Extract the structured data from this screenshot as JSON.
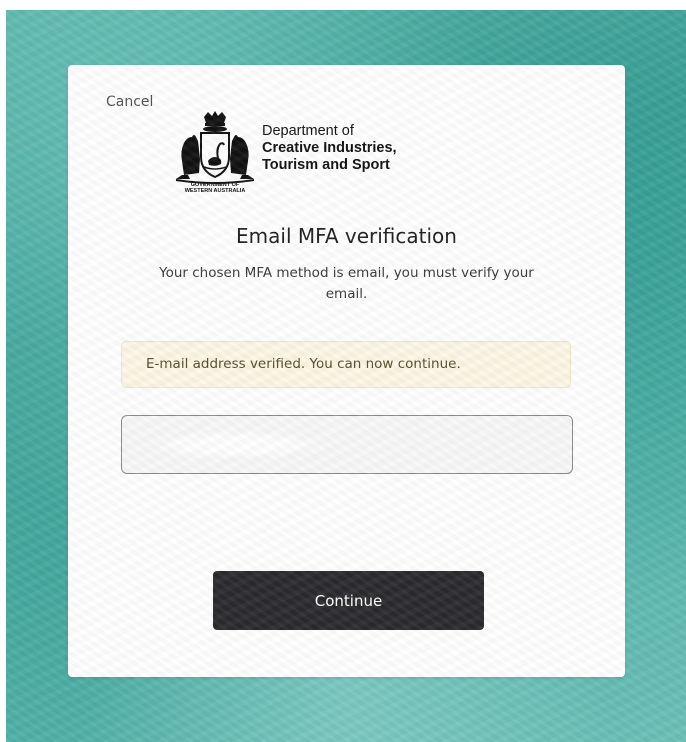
{
  "page": {
    "cancel_label": "Cancel",
    "logo": {
      "crest_caption_line1": "GOVERNMENT OF",
      "crest_caption_line2": "WESTERN AUSTRALIA",
      "dept_line1": "Department of",
      "dept_line2": "Creative Industries,",
      "dept_line3": "Tourism and Sport"
    },
    "title": "Email MFA verification",
    "subtitle": "Your chosen MFA method is email, you must verify your email.",
    "alert_text": "E-mail address verified. You can now continue.",
    "email_field": {
      "value": "",
      "placeholder": ""
    },
    "continue_label": "Continue"
  },
  "colors": {
    "background_teal": "#4cb0a6",
    "alert_background": "#fcf7e4",
    "button_background": "#2b2a2e"
  }
}
